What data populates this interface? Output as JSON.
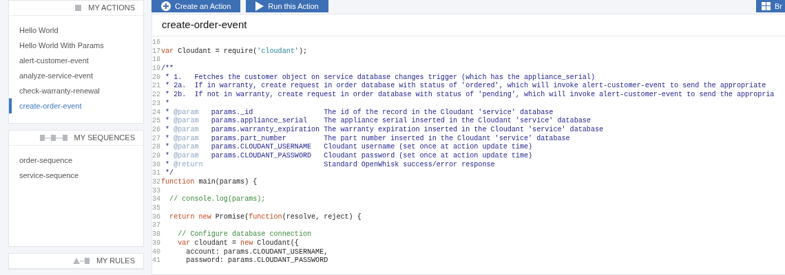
{
  "toolbar": {
    "buttons": [
      {
        "label": "Create an Action",
        "kind": "create"
      },
      {
        "label": "Run this Action",
        "kind": "run"
      }
    ],
    "right_button": {
      "label": "Br",
      "kind": "grid"
    }
  },
  "sidebar": {
    "sections": [
      {
        "title": "MY ACTIONS",
        "kind": "actions",
        "items": [
          {
            "label": "Hello World",
            "selected": false
          },
          {
            "label": "Hello World With Params",
            "selected": false
          },
          {
            "label": "alert-customer-event",
            "selected": false
          },
          {
            "label": "analyze-service-event",
            "selected": false
          },
          {
            "label": "check-warranty-renewal",
            "selected": false
          },
          {
            "label": "create-order-event",
            "selected": true
          }
        ]
      },
      {
        "title": "MY SEQUENCES",
        "kind": "sequences",
        "items": [
          {
            "label": "order-sequence",
            "selected": false
          },
          {
            "label": "service-sequence",
            "selected": false
          }
        ]
      },
      {
        "title": "MY RULES",
        "kind": "rules"
      }
    ]
  },
  "editor": {
    "title": "create-order-event",
    "lines": [
      {
        "number": "16"
      },
      {
        "number": "17",
        "tokens": [
          {
            "kind": "keyword",
            "text": "var"
          },
          {
            "kind": "plain",
            "text": " Cloudant = require("
          },
          {
            "kind": "string",
            "text": "'cloudant'"
          },
          {
            "kind": "plain",
            "text": ");"
          }
        ]
      },
      {
        "number": "18"
      },
      {
        "number": "19",
        "tokens": [
          {
            "kind": "doc",
            "text": "/**"
          }
        ]
      },
      {
        "number": "20",
        "tokens": [
          {
            "kind": "doc",
            "text": " * 1.   Fetches the customer object on service database changes trigger (which has the appliance_serial)"
          }
        ]
      },
      {
        "number": "21",
        "tokens": [
          {
            "kind": "doc",
            "text": " * 2a.  If in warranty, create request in order database with status of 'ordered', which will invoke alert-customer-event to send the appropriate"
          }
        ]
      },
      {
        "number": "22",
        "tokens": [
          {
            "kind": "doc",
            "text": " * 2b.  If not in warranty, create request in order database with status of 'pending', which will invoke alert-customer-event to send the appropria"
          }
        ]
      },
      {
        "number": "23",
        "tokens": [
          {
            "kind": "doc",
            "text": " *"
          }
        ]
      },
      {
        "number": "24",
        "tokens": [
          {
            "kind": "doc",
            "text": " * "
          },
          {
            "kind": "tag",
            "text": "@param"
          },
          {
            "kind": "doc",
            "text": "   params._id                 The id of the record in the Cloudant 'service' database"
          }
        ]
      },
      {
        "number": "25",
        "tokens": [
          {
            "kind": "doc",
            "text": " * "
          },
          {
            "kind": "tag",
            "text": "@param"
          },
          {
            "kind": "doc",
            "text": "   params.appliance_serial    The appliance serial inserted in the Cloudant 'service' database"
          }
        ]
      },
      {
        "number": "26",
        "tokens": [
          {
            "kind": "doc",
            "text": " * "
          },
          {
            "kind": "tag",
            "text": "@param"
          },
          {
            "kind": "doc",
            "text": "   params.warranty_expiration The warranty expiration inserted in the Cloudant 'service' database"
          }
        ]
      },
      {
        "number": "27",
        "tokens": [
          {
            "kind": "doc",
            "text": " * "
          },
          {
            "kind": "tag",
            "text": "@param"
          },
          {
            "kind": "doc",
            "text": "   params.part_number         The part number inserted in the Cloudant 'service' database"
          }
        ]
      },
      {
        "number": "28",
        "tokens": [
          {
            "kind": "doc",
            "text": " * "
          },
          {
            "kind": "tag",
            "text": "@param"
          },
          {
            "kind": "doc",
            "text": "   params.CLOUDANT_USERNAME   Cloudant username (set once at action update time)"
          }
        ]
      },
      {
        "number": "29",
        "tokens": [
          {
            "kind": "doc",
            "text": " * "
          },
          {
            "kind": "tag",
            "text": "@param"
          },
          {
            "kind": "doc",
            "text": "   params.CLOUDANT_PASSWORD   Cloudant password (set once at action update time)"
          }
        ]
      },
      {
        "number": "30",
        "tokens": [
          {
            "kind": "doc",
            "text": " * "
          },
          {
            "kind": "tag",
            "text": "@return"
          },
          {
            "kind": "doc",
            "text": "                             Standard OpenWhisk success/error response"
          }
        ]
      },
      {
        "number": "31",
        "tokens": [
          {
            "kind": "doc",
            "text": " */"
          }
        ]
      },
      {
        "number": "32",
        "tokens": [
          {
            "kind": "keyword",
            "text": "function"
          },
          {
            "kind": "plain",
            "text": " main(params) {"
          }
        ]
      },
      {
        "number": "33"
      },
      {
        "number": "34",
        "tokens": [
          {
            "kind": "comment",
            "text": "  // console.log(params);"
          }
        ]
      },
      {
        "number": "35"
      },
      {
        "number": "36",
        "tokens": [
          {
            "kind": "keyword",
            "text": "  return new"
          },
          {
            "kind": "plain",
            "text": " Promise("
          },
          {
            "kind": "keyword",
            "text": "function"
          },
          {
            "kind": "plain",
            "text": "(resolve, reject) {"
          }
        ]
      },
      {
        "number": "37"
      },
      {
        "number": "38",
        "tokens": [
          {
            "kind": "comment",
            "text": "    // Configure database connection"
          }
        ]
      },
      {
        "number": "39",
        "tokens": [
          {
            "kind": "keyword",
            "text": "    var"
          },
          {
            "kind": "plain",
            "text": " cloudant = "
          },
          {
            "kind": "keyword",
            "text": "new"
          },
          {
            "kind": "plain",
            "text": " Cloudant({"
          }
        ]
      },
      {
        "number": "40",
        "tokens": [
          {
            "kind": "plain",
            "text": "      account: params.CLOUDANT_USERNAME,"
          }
        ]
      },
      {
        "number": "41",
        "tokens": [
          {
            "kind": "plain",
            "text": "      password: params.CLOUDANT_PASSWORD"
          }
        ]
      }
    ]
  }
}
